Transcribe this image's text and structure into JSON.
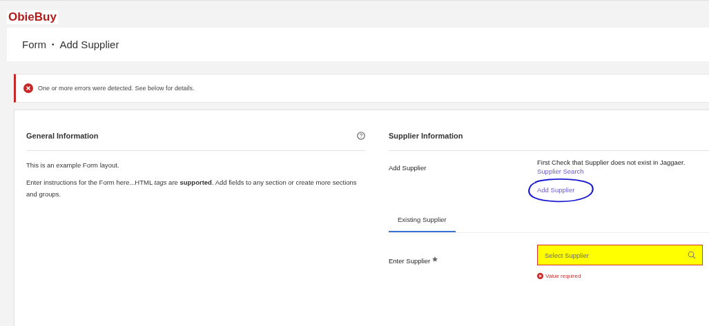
{
  "logo": "ObieBuy",
  "breadcrumb": {
    "parent": "Form",
    "separator": "•",
    "current": "Add Supplier"
  },
  "alert": {
    "message": "One or more errors were detected. See below for details."
  },
  "general": {
    "title": "General Information",
    "paragraphs": [
      "This is an example Form layout.",
      "Enter instructions for the Form here...HTML *tags* are **supported**. Add fields to any section or create more sections and groups."
    ]
  },
  "supplier": {
    "title": "Supplier Information",
    "add_label": "Add Supplier",
    "check_text": "First Check that Supplier does not exist in Jaggaer.",
    "links": [
      {
        "label": "Supplier Search",
        "circled": false
      },
      {
        "label": "Add Supplier",
        "circled": true
      }
    ],
    "tabs": [
      {
        "label": "Existing Supplier",
        "selected": true
      }
    ],
    "field": {
      "label": "Enter Supplier",
      "required": true,
      "placeholder": "Select Supplier",
      "highlighted": true,
      "error": "Value required"
    }
  }
}
